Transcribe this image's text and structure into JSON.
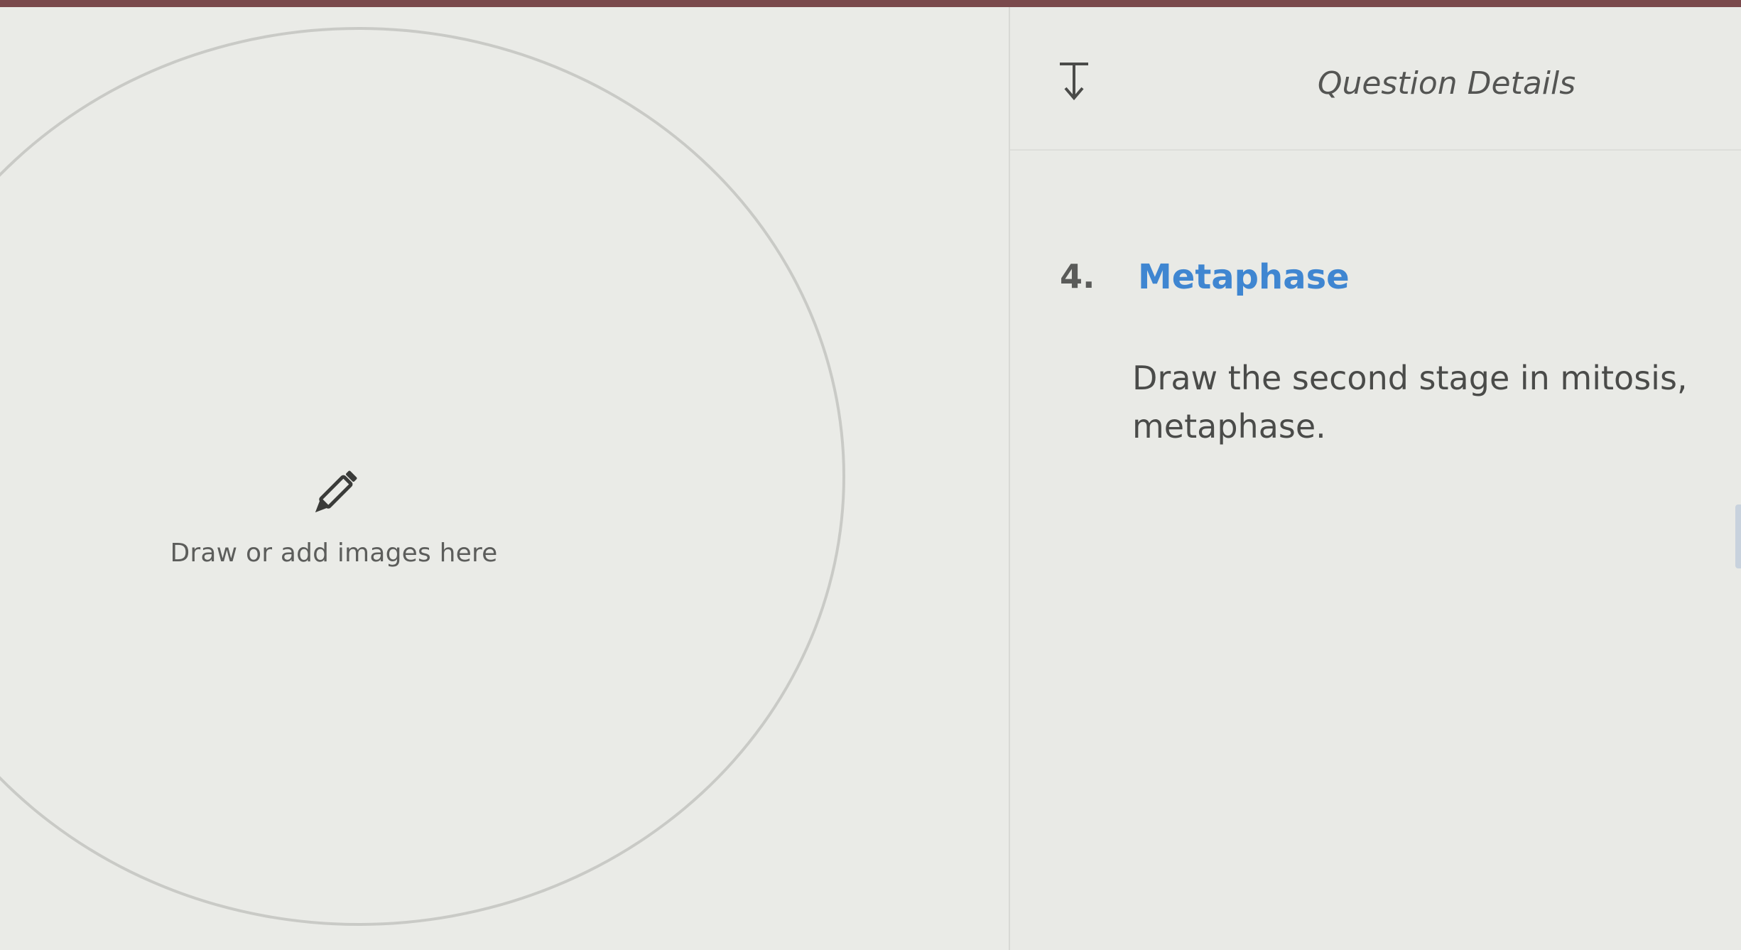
{
  "canvas": {
    "hint_text": "Draw or add images here",
    "hint_icon": "pencil-icon"
  },
  "details": {
    "collapse_icon": "collapse-down-icon",
    "header_title": "Question Details",
    "question_number": "4.",
    "question_title": "Metaphase",
    "question_prompt": "Draw the second stage in mitosis, metaphase."
  },
  "colors": {
    "accent_blue": "#3f86d1",
    "top_strip": "#7a4a4c"
  }
}
